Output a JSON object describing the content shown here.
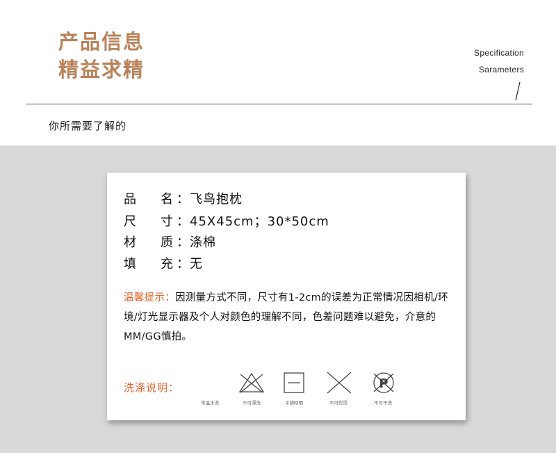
{
  "header": {
    "title_line1": "产品信息",
    "title_line2": "精益求精",
    "en_line1": "Specification",
    "en_line2": "Sarameters"
  },
  "subtitle": "你所需要了解的",
  "specs": [
    {
      "label_a": "品",
      "label_b": "名",
      "value": "飞鸟抱枕"
    },
    {
      "label_a": "尺",
      "label_b": "寸",
      "value": "45X45cm；30*50cm"
    },
    {
      "label_a": "材",
      "label_b": "质",
      "value": "涤棉"
    },
    {
      "label_a": "填",
      "label_b": "充",
      "value": "无"
    }
  ],
  "colon": "：",
  "note": {
    "label": "温馨提示：",
    "text": "因测量方式不同，尺寸有1-2cm的误差为正常情况因相机/环境/灯光显示器及个人对颜色的理解不同，色差问题难以避免，介意的MM/GG慎拍。"
  },
  "wash": {
    "label": "洗涤说明：",
    "icons": [
      {
        "icon": "no-bleach-icon",
        "caption": "常温水洗"
      },
      {
        "icon": "tumble-dry-flat-icon",
        "caption": "不可漂洗"
      },
      {
        "icon": "no-iron-icon",
        "caption": "平铺晾晒"
      },
      {
        "icon": "no-dry-clean-icon",
        "caption": "不可熨烫"
      },
      {
        "icon": "no-dry-clean-p-icon",
        "caption": "不可干洗"
      }
    ]
  },
  "colors": {
    "title": "#b9825a",
    "accent": "#e8642a",
    "band": "#d9d9d9"
  }
}
